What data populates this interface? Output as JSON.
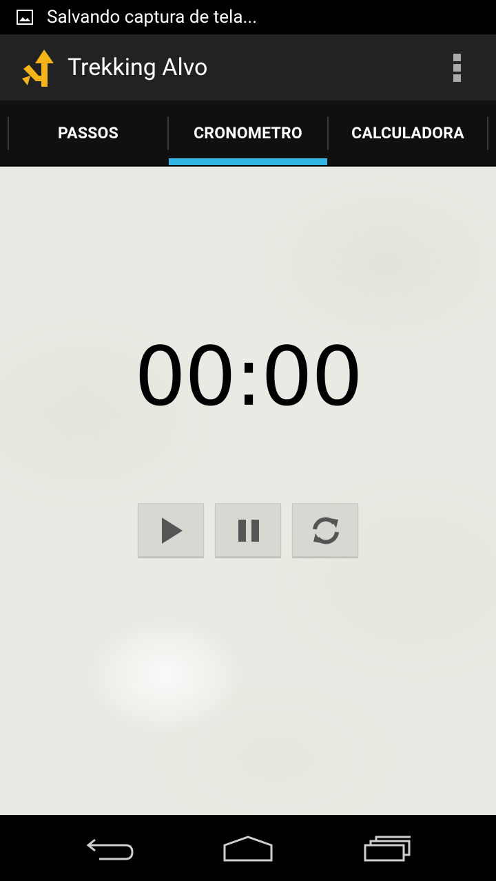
{
  "status_bar": {
    "notification_icon": "image-icon",
    "notification_text": "Salvando captura de tela..."
  },
  "action_bar": {
    "app_icon": "turn-arrow-icon",
    "title": "Trekking Alvo",
    "overflow_icon": "more-vert-icon"
  },
  "tabs": [
    {
      "label": "PASSOS",
      "selected": false
    },
    {
      "label": "CRONOMETRO",
      "selected": true
    },
    {
      "label": "CALCULADORA",
      "selected": false
    }
  ],
  "stopwatch": {
    "time": "00:00",
    "controls": [
      {
        "name": "play",
        "icon": "play-icon"
      },
      {
        "name": "pause",
        "icon": "pause-icon"
      },
      {
        "name": "reset",
        "icon": "refresh-icon"
      }
    ]
  },
  "nav_bar": {
    "items": [
      "back-icon",
      "home-icon",
      "recent-apps-icon"
    ]
  },
  "colors": {
    "tab_indicator": "#33b5e5",
    "app_icon": "#f5b51a",
    "content_background": "#e8ebe3"
  }
}
